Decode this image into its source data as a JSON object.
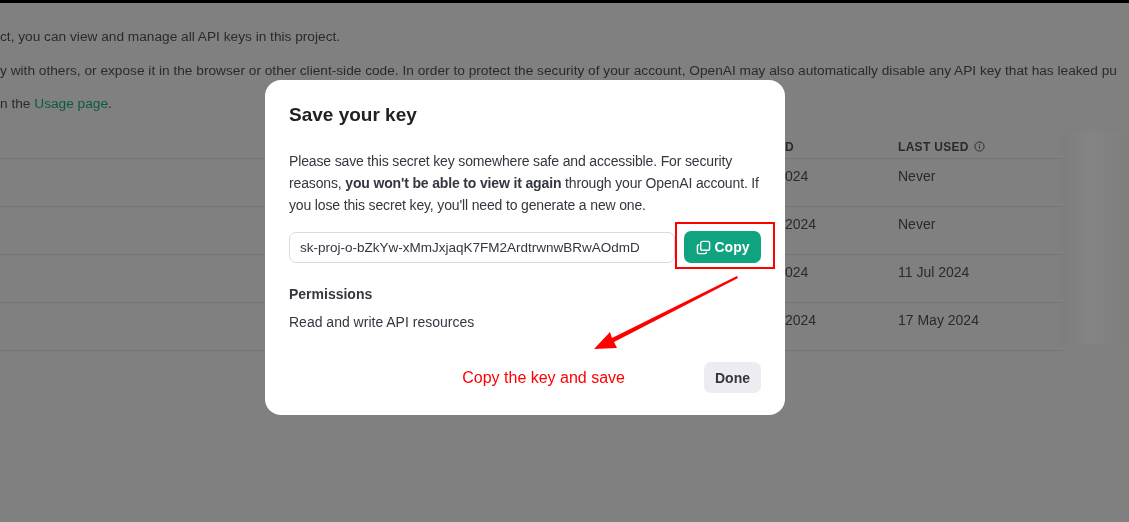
{
  "background": {
    "paragraphs": [
      {
        "text": "ct, you can view and manage all API keys in this project."
      },
      {
        "text": "y with others, or expose it in the browser or other client-side code. In order to protect the security of your account, OpenAI may also automatically disable any API key that has leaked pu"
      },
      {
        "text": "n the ",
        "link": "Usage page",
        "after": "."
      }
    ],
    "table": {
      "columns": [
        "D",
        "LAST USED"
      ],
      "rows": [
        [
          "024",
          "Never"
        ],
        [
          "2024",
          "Never"
        ],
        [
          "024",
          "11 Jul 2024"
        ],
        [
          "2024",
          "17 May 2024"
        ]
      ]
    }
  },
  "dialog": {
    "title": "Save your key",
    "message": "Please save this secret key somewhere safe and accessible. For security reasons, **you won't be able to view it again** through your OpenAI account. If you lose this secret key, you'll need to generate a new one.",
    "key_field": {
      "value": "sk-proj-o-bZkYw-xMmJxjaqK7FM2ArdtrwnwBRwAOdmD"
    },
    "copy_button": "Copy",
    "permissions": {
      "heading": "Permissions",
      "text": "Read and write API resources"
    },
    "done_button": "Done"
  },
  "annotation": {
    "text": "Copy the key and save"
  }
}
